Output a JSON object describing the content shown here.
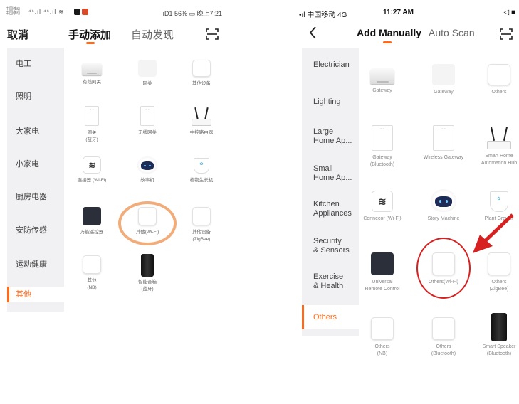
{
  "colors": {
    "accent": "#ff6a1a",
    "annotation_left": "#f0a36a",
    "annotation_right": "#d72020"
  },
  "left_phone": {
    "status": {
      "carrier_top": "中国移动",
      "carrier_bottom": "中国移动",
      "signal": "⁴⁶.ıl ⁴⁶.ıl ≋",
      "right": "ıD1 56% ▭ 晚上7:21"
    },
    "nav": {
      "cancel": "取消",
      "tab_manual": "手动添加",
      "tab_auto": "自动发现"
    },
    "sidebar": [
      "电工",
      "照明",
      "大家电",
      "小家电",
      "厨房电器",
      "安防传感",
      "运动健康",
      "其他"
    ],
    "devices": [
      {
        "label": "有线网关",
        "icon": "gateway-icon"
      },
      {
        "label": "网关",
        "icon": "blank-icon"
      },
      {
        "label": "其他设备",
        "icon": "plain-device-icon"
      },
      {
        "label": "网关\n(蓝牙)",
        "icon": "tall-gateway-icon"
      },
      {
        "label": "无线网关",
        "icon": "tall-gateway-icon"
      },
      {
        "label": "中控路由器",
        "icon": "router-icon"
      },
      {
        "label": "连接器 (Wi-Fi)",
        "icon": "wifi-connector-icon"
      },
      {
        "label": "故事机",
        "icon": "robot-icon"
      },
      {
        "label": "植物生长机",
        "icon": "plant-pot-icon"
      },
      {
        "label": "万能遥控器",
        "icon": "remote-icon"
      },
      {
        "label": "其他(Wi-Fi)",
        "icon": "plain-device-icon"
      },
      {
        "label": "其他设备\n(ZigBee)",
        "icon": "plain-device-icon"
      },
      {
        "label": "其他\n(NB)",
        "icon": "plain-device-icon"
      },
      {
        "label": "智能音箱\n(蓝牙)",
        "icon": "speaker-icon"
      }
    ]
  },
  "right_phone": {
    "status": {
      "carrier": "•ıl 中国移动  4G",
      "time": "11:27 AM",
      "right": "◁ ■"
    },
    "nav": {
      "tab_manual": "Add Manually",
      "tab_auto": "Auto Scan"
    },
    "sidebar": [
      "Electrician",
      "Lighting",
      "Large\nHome Ap...",
      "Small\nHome Ap...",
      "Kitchen\nAppliances",
      "Security\n& Sensors",
      "Exercise\n& Health",
      "Others"
    ],
    "devices": [
      {
        "label": "Gateway",
        "icon": "gateway-icon"
      },
      {
        "label": "Gateway",
        "icon": "blank-icon"
      },
      {
        "label": "Others",
        "icon": "plain-device-icon"
      },
      {
        "label": "Gateway\n(Bluetooth)",
        "icon": "tall-gateway-icon"
      },
      {
        "label": "Wireless Gateway",
        "icon": "tall-gateway-icon"
      },
      {
        "label": "Smart Home\nAutomation Hub",
        "icon": "router-icon"
      },
      {
        "label": "Connecor (Wi-Fi)",
        "icon": "wifi-connector-icon"
      },
      {
        "label": "Story Machine",
        "icon": "robot-icon"
      },
      {
        "label": "Plant Grower",
        "icon": "plant-pot-icon"
      },
      {
        "label": "Universal\nRemote Control",
        "icon": "remote-icon"
      },
      {
        "label": "Others(Wi-Fi)",
        "icon": "plain-device-icon"
      },
      {
        "label": "Others\n(ZigBee)",
        "icon": "plain-device-icon"
      },
      {
        "label": "Others\n(NB)",
        "icon": "plain-device-icon"
      },
      {
        "label": "Others\n(Bluetooth)",
        "icon": "plain-device-icon"
      },
      {
        "label": "Smart Speaker\n(Bluetooth)",
        "icon": "speaker-icon"
      }
    ]
  }
}
